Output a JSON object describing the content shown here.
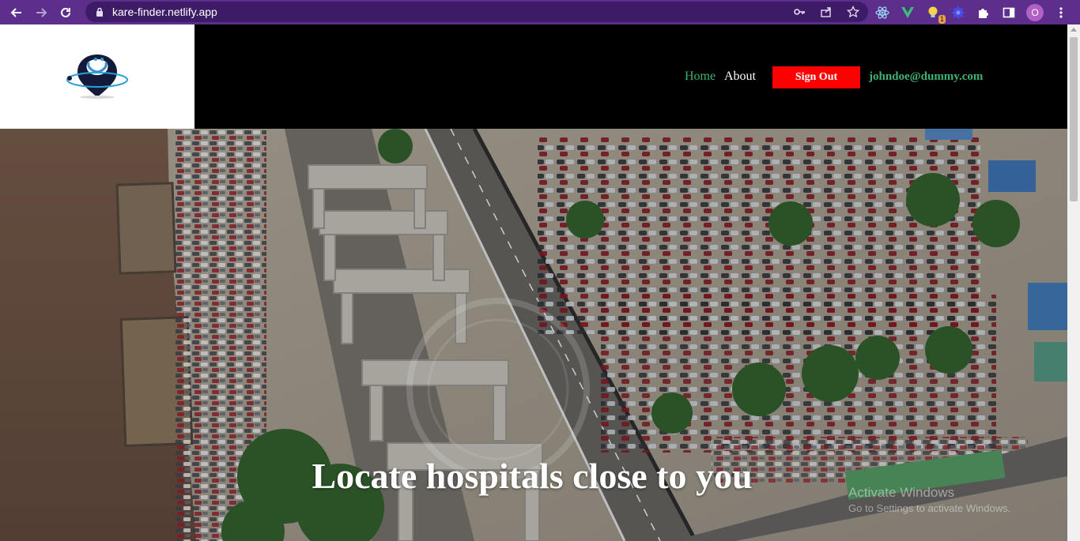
{
  "browser": {
    "url": "kare-finder.netlify.app",
    "profile_initial": "O",
    "extension_badge": "1",
    "icons": [
      "back-arrow-icon",
      "forward-arrow-icon",
      "reload-icon",
      "lock-icon",
      "key-icon",
      "share-icon",
      "star-icon",
      "react-devtools-icon",
      "vue-devtools-icon",
      "lightbulb-extension-icon",
      "settings-extension-icon",
      "puzzle-icon",
      "side-panel-icon",
      "avatar",
      "menu-dots-icon"
    ]
  },
  "header": {
    "nav": {
      "home": "Home",
      "about": "About"
    },
    "sign_out": "Sign Out",
    "user_email": "johndoe@dummy.com"
  },
  "hero": {
    "title": "Locate hospitals close to you"
  },
  "os_watermark": {
    "line1": "Activate Windows",
    "line2": "Go to Settings to activate Windows."
  },
  "colors": {
    "browser_frame": "#5d2e8c",
    "accent_green": "#3cb371",
    "sign_out_bg": "#ff0000",
    "header_bg": "#000000"
  }
}
